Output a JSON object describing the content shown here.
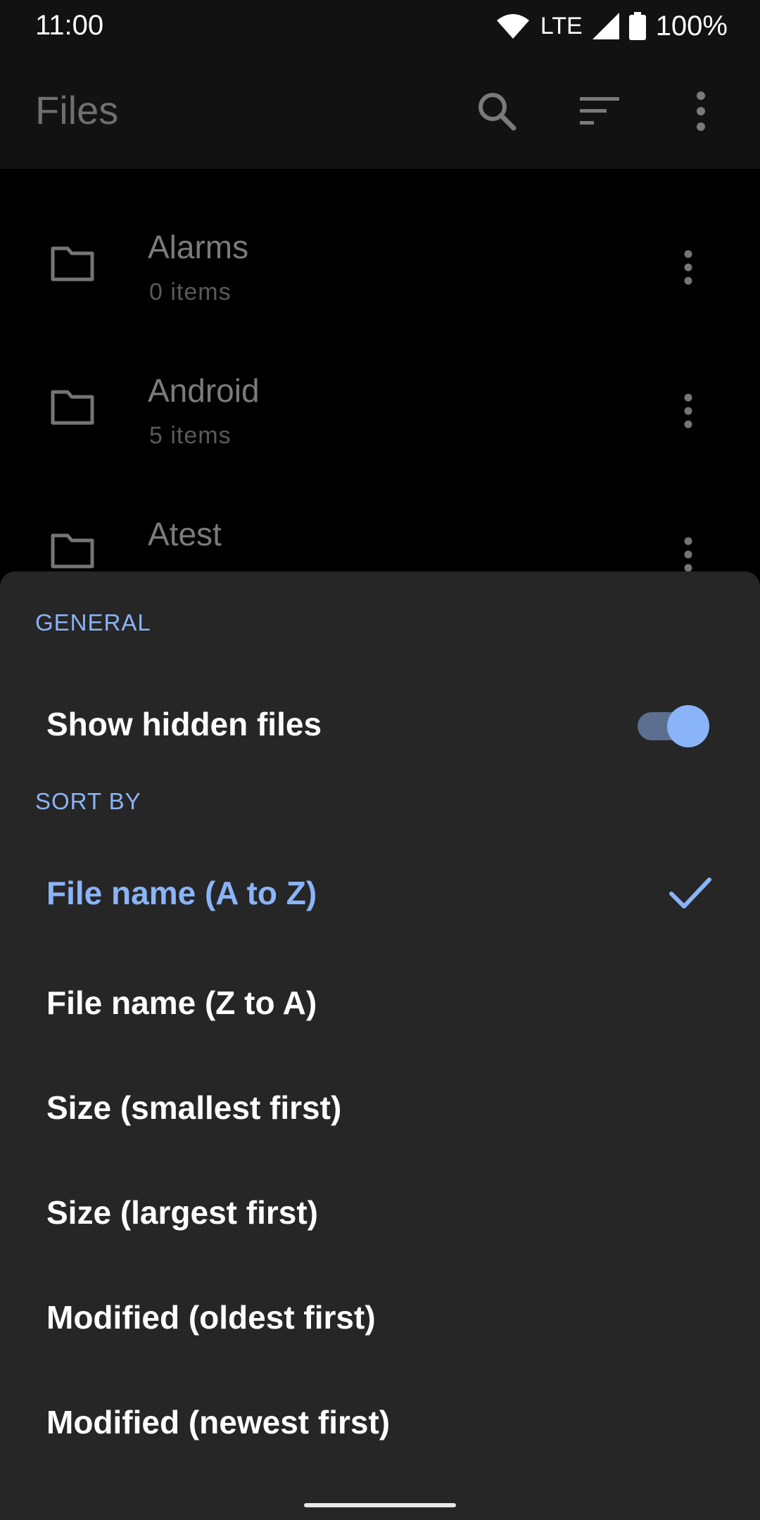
{
  "status_bar": {
    "time": "11:00",
    "network": "LTE",
    "battery": "100%",
    "icons": [
      "wifi-icon",
      "signal-icon",
      "battery-icon"
    ]
  },
  "app_bar": {
    "title": "Files",
    "actions": [
      "search-icon",
      "sort-icon",
      "more-vert-icon"
    ]
  },
  "folders": [
    {
      "name": "Alarms",
      "count": "0 items"
    },
    {
      "name": "Android",
      "count": "5 items"
    },
    {
      "name": "Atest",
      "count": ""
    }
  ],
  "sheet": {
    "general_label": "GENERAL",
    "show_hidden_label": "Show hidden files",
    "show_hidden_on": true,
    "sort_label": "SORT BY",
    "sort_options": [
      {
        "label": "File name (A to Z)",
        "selected": true
      },
      {
        "label": "File name (Z to A)",
        "selected": false
      },
      {
        "label": "Size (smallest first)",
        "selected": false
      },
      {
        "label": "Size (largest first)",
        "selected": false
      },
      {
        "label": "Modified (oldest first)",
        "selected": false
      },
      {
        "label": "Modified (newest first)",
        "selected": false
      }
    ]
  },
  "colors": {
    "accent": "#8ab4f8",
    "sheet_bg": "#262626",
    "appbar_bg": "#121212"
  }
}
